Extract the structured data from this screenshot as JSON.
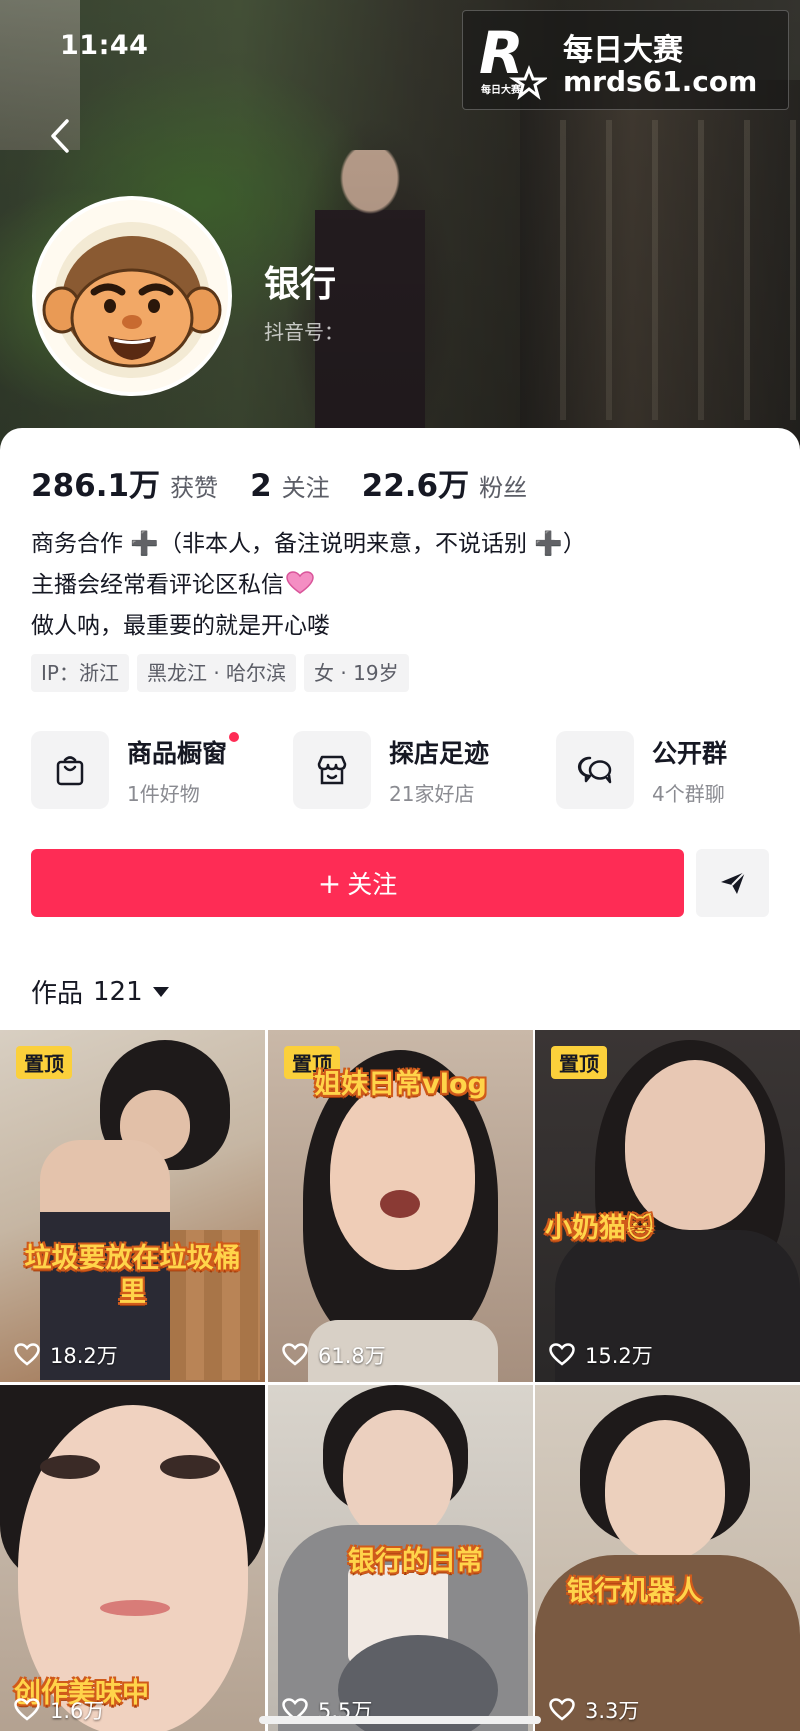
{
  "status_bar": {
    "time": "11:44"
  },
  "watermark": {
    "logo_letter": "R",
    "logo_sub": "每日大赛",
    "title": "每日大赛",
    "url": "mrds61.com"
  },
  "profile": {
    "name": "银行",
    "id_label": "抖音号：",
    "stats": [
      {
        "num": "286.1万",
        "label": "获赞"
      },
      {
        "num": "2",
        "label": "关注"
      },
      {
        "num": "22.6万",
        "label": "粉丝"
      }
    ],
    "bio": [
      "商务合作 ➕（非本人，备注说明来意，不说话别 ➕）",
      "主播会经常看评论区私信",
      "做人呐，最重要的就是开心喽"
    ],
    "tags": [
      "IP：浙江",
      "黑龙江 · 哈尔滨",
      "女 · 19岁"
    ]
  },
  "features": [
    {
      "title": "商品橱窗",
      "subtitle": "1件好物",
      "icon": "bag-icon",
      "has_dot": true
    },
    {
      "title": "探店足迹",
      "subtitle": "21家好店",
      "icon": "store-icon",
      "has_dot": false
    },
    {
      "title": "公开群",
      "subtitle": "4个群聊",
      "icon": "chat-bubbles-icon",
      "has_dot": false
    }
  ],
  "actions": {
    "follow_plus": "+",
    "follow_label": "关注"
  },
  "works": {
    "label": "作品",
    "count": "121"
  },
  "videos": [
    {
      "pinned": true,
      "pin_label": "置顶",
      "caption": "垃圾要放在垃圾桶里",
      "likes": "18.2万"
    },
    {
      "pinned": true,
      "pin_label": "置顶",
      "caption": "姐妹日常vlog",
      "likes": "61.8万"
    },
    {
      "pinned": true,
      "pin_label": "置顶",
      "caption": "小奶猫🐱",
      "likes": "15.2万"
    },
    {
      "pinned": false,
      "pin_label": "",
      "caption": "创作美味中",
      "likes": "1.6万"
    },
    {
      "pinned": false,
      "pin_label": "",
      "caption": "银行的日常",
      "likes": "5.5万"
    },
    {
      "pinned": false,
      "pin_label": "",
      "caption": "银行机器人",
      "likes": "3.3万"
    }
  ],
  "colors": {
    "accent": "#fe2c55",
    "pin": "#fbd03b",
    "caption": "#ffd44a"
  }
}
